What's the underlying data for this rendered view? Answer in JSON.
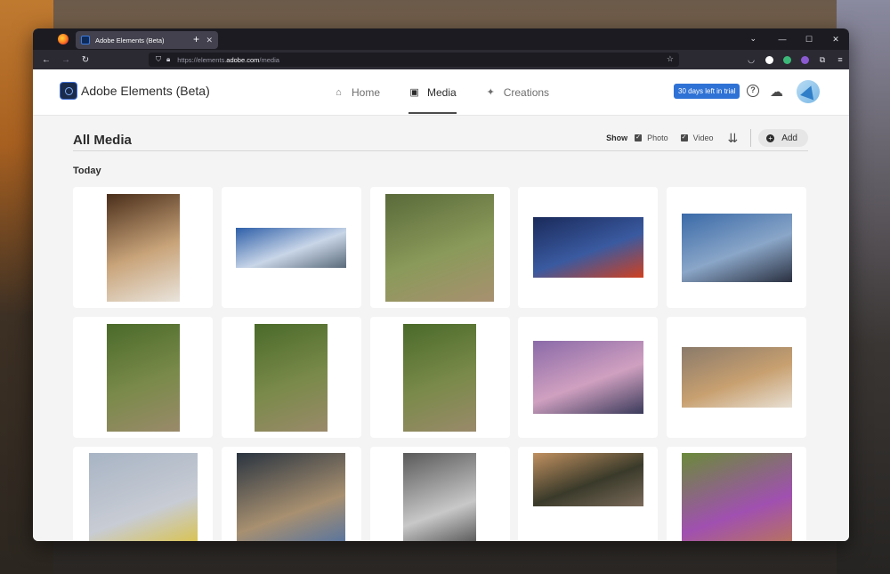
{
  "browser": {
    "tab_title": "Adobe Elements (Beta)",
    "url_prefix": "https://elements.",
    "url_domain": "adobe.com",
    "url_path": "/media"
  },
  "app": {
    "title": "Adobe Elements (Beta)",
    "nav": [
      {
        "label": "Home",
        "icon": "home-icon"
      },
      {
        "label": "Media",
        "icon": "media-icon"
      },
      {
        "label": "Creations",
        "icon": "creations-icon"
      }
    ],
    "trial_badge": "30 days left in trial",
    "accent_color": "#2f72d6"
  },
  "page": {
    "title": "All Media",
    "show_label": "Show",
    "filter_photo": "Photo",
    "filter_video": "Video",
    "add_label": "Add",
    "section": "Today"
  },
  "media": [
    {
      "name": "tree-bark",
      "colors": [
        "#4a2e1a",
        "#c9a47a",
        "#e9e4dc"
      ]
    },
    {
      "name": "sky-clouds",
      "colors": [
        "#2e5fa8",
        "#c9d6e8",
        "#5a6a7a"
      ]
    },
    {
      "name": "rabbit-in-bush",
      "colors": [
        "#5a6a3a",
        "#8a9a5a",
        "#a89070"
      ]
    },
    {
      "name": "simpsons-scene",
      "colors": [
        "#1a2a5a",
        "#3a5aa0",
        "#d04020"
      ]
    },
    {
      "name": "lake-dusk",
      "colors": [
        "#3a6aa8",
        "#8aa6c8",
        "#2a3040"
      ]
    },
    {
      "name": "rabbit-1",
      "colors": [
        "#4a6a2a",
        "#7a8a4a",
        "#9a8a6a"
      ]
    },
    {
      "name": "rabbit-2",
      "colors": [
        "#4a6a2a",
        "#7a8a4a",
        "#9a8a6a"
      ]
    },
    {
      "name": "rabbit-3",
      "colors": [
        "#4a6a2a",
        "#7a8a4a",
        "#9a8a6a"
      ]
    },
    {
      "name": "purple-lake",
      "colors": [
        "#8a6aa8",
        "#d0a0c0",
        "#3a3a5a"
      ]
    },
    {
      "name": "kitten",
      "colors": [
        "#8a7a6a",
        "#c8a070",
        "#e8e0d4"
      ]
    },
    {
      "name": "finches",
      "colors": [
        "#a8b4c4",
        "#c8ccd4",
        "#e0c020"
      ]
    },
    {
      "name": "bluebird",
      "colors": [
        "#2a3440",
        "#a89070",
        "#3a6ab0"
      ]
    },
    {
      "name": "wire-mesh",
      "colors": [
        "#5a5a5a",
        "#c8c8c8",
        "#2a2a2a"
      ]
    },
    {
      "name": "sunset-lake",
      "colors": [
        "#c09060",
        "#3a3a2a",
        "#7a6a5a"
      ]
    },
    {
      "name": "butterfly-flowers",
      "colors": [
        "#6a8a3a",
        "#a050b0",
        "#c08040"
      ]
    }
  ]
}
